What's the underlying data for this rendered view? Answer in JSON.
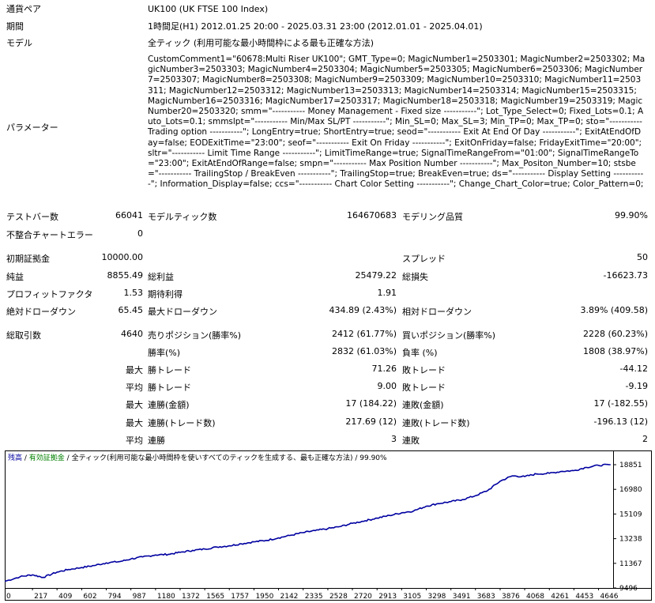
{
  "summary": {
    "pair_label": "通貨ペア",
    "pair_value": "UK100 (UK FTSE 100 Index)",
    "period_label": "期間",
    "period_value": "1時間足(H1) 2012.01.25 20:00 - 2025.03.31 23:00 (2012.01.01 - 2025.04.01)",
    "model_label": "モデル",
    "model_value": "全ティック (利用可能な最小時間枠による最も正確な方法)",
    "params_label": "パラメーター",
    "params_value": "CustomComment1=\"60678:Multi Riser UK100\"; GMT_Type=0; MagicNumber1=2503301; MagicNumber2=2503302; MagicNumber3=2503303; MagicNumber4=2503304; MagicNumber5=2503305; MagicNumber6=2503306; MagicNumber7=2503307; MagicNumber8=2503308; MagicNumber9=2503309; MagicNumber10=2503310; MagicNumber11=2503311; MagicNumber12=2503312; MagicNumber13=2503313; MagicNumber14=2503314; MagicNumber15=2503315; MagicNumber16=2503316; MagicNumber17=2503317; MagicNumber18=2503318; MagicNumber19=2503319; MagicNumber20=2503320; smm=\"----------- Money Management - Fixed size -----------\"; Lot_Type_Select=0; Fixed_Lots=0.1; Auto_Lots=0.1; smmslpt=\"----------- Min/Max SL/PT -----------\"; Min_SL=0; Max_SL=3; Min_TP=0; Max_TP=0; sto=\"----------- Trading option -----------\"; LongEntry=true; ShortEntry=true; seod=\"----------- Exit At End Of Day -----------\"; ExitAtEndOfDay=false; EODExitTime=\"23:00\"; seof=\"----------- Exit On Friday -----------\"; ExitOnFriday=false; FridayExitTime=\"20:00\"; sltr=\"----------- Limit Time Range -----------\"; LimitTimeRange=true; SignalTimeRangeFrom=\"01:00\"; SignalTimeRangeTo=\"23:00\"; ExitAtEndOfRange=false; smpn=\"----------- Max Position Number -----------\"; Max_Positon_Number=10; stsbe=\"----------- TrailingStop / BreakEven -----------\"; TrailingStop=true; BreakEven=true; ds=\"----------- Display Setting -----------\"; Information_Display=false; ccs=\"----------- Chart Color Setting -----------\"; Change_Chart_Color=true; Color_Pattern=0;"
  },
  "stats": {
    "bars_label": "テストバー数",
    "bars_value": "66041",
    "ticks_label": "モデルティック数",
    "ticks_value": "164670683",
    "quality_label": "モデリング品質",
    "quality_value": "99.90%",
    "mismatch_label": "不整合チャートエラー",
    "mismatch_value": "0",
    "deposit_label": "初期証拠金",
    "deposit_value": "10000.00",
    "spread_label": "スプレッド",
    "spread_value": "50",
    "net_label": "純益",
    "net_value": "8855.49",
    "gross_profit_label": "総利益",
    "gross_profit_value": "25479.22",
    "gross_loss_label": "総損失",
    "gross_loss_value": "-16623.73",
    "pf_label": "プロフィットファクタ",
    "pf_value": "1.53",
    "expected_label": "期待利得",
    "expected_value": "1.91",
    "abs_dd_label": "絶対ドローダウン",
    "abs_dd_value": "65.45",
    "max_dd_label": "最大ドローダウン",
    "max_dd_value": "434.89 (2.43%)",
    "rel_dd_label": "相対ドローダウン",
    "rel_dd_value": "3.89% (409.58)",
    "trades_label": "総取引数",
    "trades_value": "4640",
    "short_label": "売りポジション(勝率%)",
    "short_value": "2412 (61.77%)",
    "long_label": "買いポジション(勝率%)",
    "long_value": "2228 (60.23%)",
    "winrate_label": "勝率(%)",
    "winrate_value": "2832 (61.03%)",
    "lossrate_label": "負率 (%)",
    "lossrate_value": "1808 (38.97%)",
    "max_label": "最大",
    "avg_label": "平均",
    "largest_win_label": "勝トレード",
    "largest_win_value": "71.26",
    "largest_loss_label": "敗トレード",
    "largest_loss_value": "-44.12",
    "avg_win_label": "勝トレード",
    "avg_win_value": "9.00",
    "avg_loss_label": "敗トレード",
    "avg_loss_value": "-9.19",
    "max_consec_win_amt_label": "連勝(金額)",
    "max_consec_win_amt_value": "17 (184.22)",
    "max_consec_loss_amt_label": "連敗(金額)",
    "max_consec_loss_amt_value": "17 (-182.55)",
    "max_consec_win_cnt_label": "連勝(トレード数)",
    "max_consec_win_cnt_value": "217.69 (12)",
    "max_consec_loss_cnt_label": "連敗(トレード数)",
    "max_consec_loss_cnt_value": "-196.13 (12)",
    "avg_consec_win_label": "連勝",
    "avg_consec_win_value": "3",
    "avg_consec_loss_label": "連敗",
    "avg_consec_loss_value": "2"
  },
  "chart_legend": {
    "balance": "残高",
    "separator1": " / ",
    "margin": "有効証拠金",
    "separator2": " / ",
    "rest": "全ティック(利用可能な最小時間枠を使いすべてのティックを生成する、最も正確な方法) / 99.90%"
  },
  "colors": {
    "line": "#0000a0",
    "legend_green": "#008000"
  },
  "chart_data": {
    "type": "line",
    "x_ticks": [
      "0",
      "217",
      "409",
      "602",
      "794",
      "987",
      "1180",
      "1372",
      "1565",
      "1757",
      "1950",
      "2142",
      "2335",
      "2528",
      "2720",
      "2913",
      "3105",
      "3298",
      "3491",
      "3683",
      "3876",
      "4068",
      "4261",
      "4453",
      "4646"
    ],
    "y_ticks": [
      "18851",
      "16980",
      "15109",
      "13238",
      "11367",
      "9496"
    ],
    "ylim": [
      9496,
      18851
    ],
    "xlim": [
      0,
      4760
    ],
    "series": [
      {
        "name": "残高",
        "x": [
          0,
          120,
          217,
          300,
          409,
          500,
          602,
          700,
          794,
          900,
          987,
          1080,
          1180,
          1280,
          1372,
          1470,
          1565,
          1660,
          1757,
          1850,
          1950,
          2040,
          2142,
          2240,
          2335,
          2430,
          2528,
          2620,
          2720,
          2820,
          2913,
          3010,
          3105,
          3200,
          3298,
          3390,
          3491,
          3580,
          3683,
          3780,
          3876,
          3970,
          4068,
          4160,
          4261,
          4360,
          4453,
          4550,
          4646,
          4740
        ],
        "y": [
          10000,
          10350,
          10500,
          10300,
          10700,
          10900,
          11050,
          11200,
          11400,
          11500,
          11700,
          11850,
          12000,
          12050,
          12200,
          12350,
          12450,
          12600,
          12700,
          12850,
          13000,
          13100,
          13300,
          13500,
          13700,
          13850,
          14000,
          14150,
          14400,
          14600,
          14800,
          15000,
          15200,
          15350,
          15700,
          15900,
          16050,
          16200,
          16500,
          16900,
          17600,
          18000,
          17950,
          18150,
          18200,
          18350,
          18400,
          18650,
          18800,
          18851
        ]
      }
    ]
  }
}
